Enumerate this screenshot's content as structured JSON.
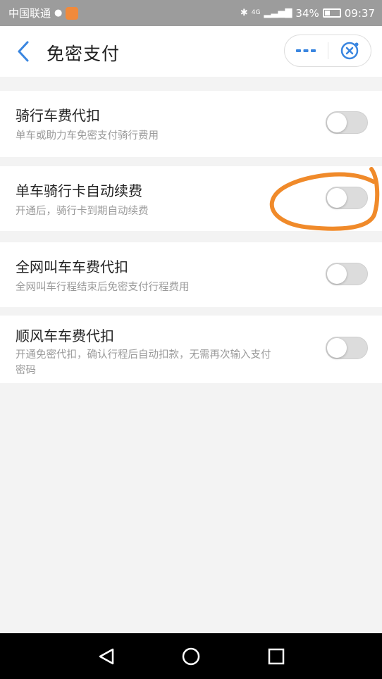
{
  "status_bar": {
    "carrier": "中国联通",
    "network": "4G",
    "battery": "34%",
    "time": "09:37",
    "icons": [
      "wechat-icon",
      "app-notification-icon",
      "bluetooth-icon",
      "signal-icon",
      "battery-icon"
    ]
  },
  "nav": {
    "title": "免密支付",
    "back_icon": "chevron-left-icon",
    "more_icon": "more-dots-icon",
    "close_icon": "close-target-icon",
    "accent_color": "#3a86e0"
  },
  "settings": [
    {
      "title": "骑行车费代扣",
      "desc": "单车或助力车免密支付骑行费用",
      "enabled": false
    },
    {
      "title": "单车骑行卡自动续费",
      "desc": "开通后，骑行卡到期自动续费",
      "enabled": false
    },
    {
      "title": "全网叫车车费代扣",
      "desc": "全网叫车行程结束后免密支付行程费用",
      "enabled": false
    },
    {
      "title": "顺风车车费代扣",
      "desc_line1": "开通免密代扣，确认行程后自动扣款，无需再次输入支付",
      "desc_line2": "密码",
      "enabled": false
    }
  ],
  "annotation": {
    "shape": "hand-drawn-circle",
    "color": "#f08a2a",
    "target": "单车骑行卡自动续费 toggle"
  },
  "system_nav": {
    "back_icon": "triangle-back-icon",
    "home_icon": "circle-home-icon",
    "recents_icon": "square-recents-icon"
  }
}
